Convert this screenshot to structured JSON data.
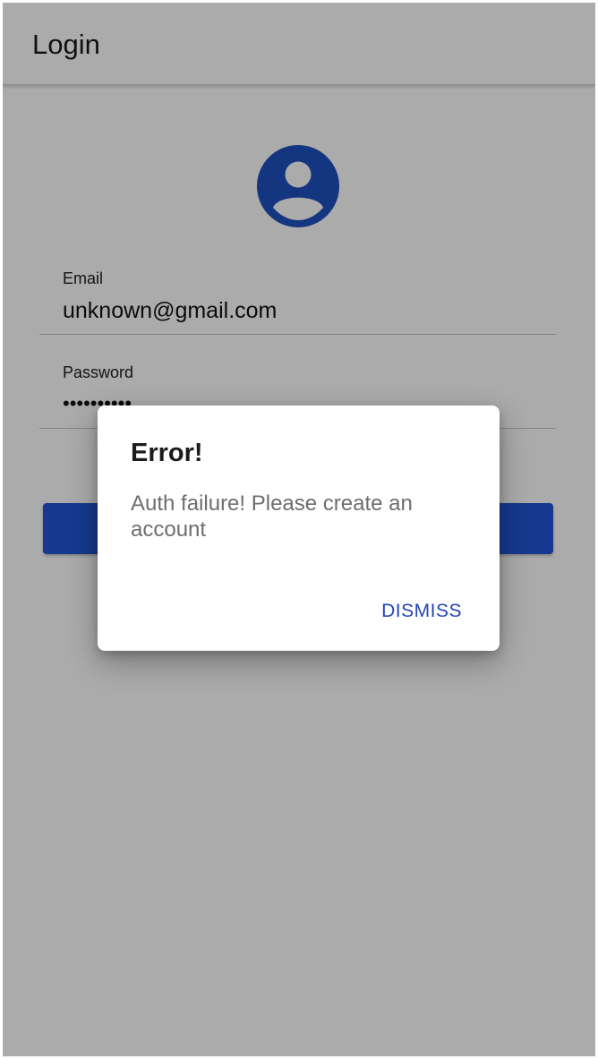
{
  "header": {
    "title": "Login"
  },
  "form": {
    "email": {
      "label": "Email",
      "value": "unknown@gmail.com"
    },
    "password": {
      "label": "Password",
      "value": "••••••••••"
    },
    "login_button_label": ""
  },
  "dialog": {
    "title": "Error!",
    "message": "Auth failure! Please create an account",
    "dismiss_label": "DISMISS"
  },
  "icons": {
    "avatar": "account-circle-icon"
  },
  "colors": {
    "accent": "#2255d6",
    "avatar": "#1f4fbf",
    "dialog_button": "#2347b5"
  }
}
